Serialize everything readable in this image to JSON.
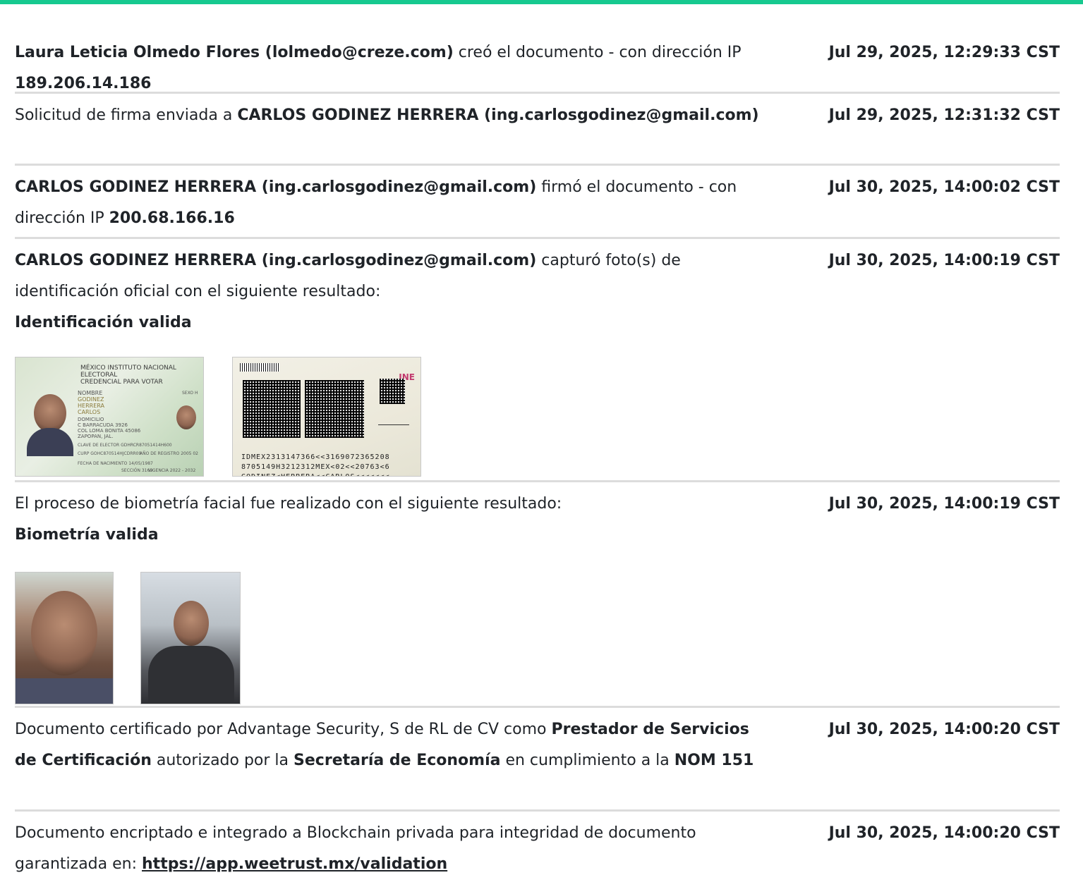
{
  "entries": [
    {
      "parts": [
        {
          "t": "Laura Leticia Olmedo Flores (lolmedo@creze.com)",
          "b": true
        },
        {
          "t": " creó el documento - con dirección IP ",
          "b": false
        },
        {
          "t": "189.206.14.186",
          "b": true
        }
      ],
      "date": "Jul 29, 2025, 12:29:33 CST"
    },
    {
      "parts": [
        {
          "t": "Solicitud de firma enviada a ",
          "b": false
        },
        {
          "t": "CARLOS GODINEZ HERRERA (ing.carlosgodinez@gmail.com)",
          "b": true
        }
      ],
      "date": "Jul 29, 2025, 12:31:32 CST"
    },
    {
      "parts": [
        {
          "t": "CARLOS GODINEZ HERRERA (ing.carlosgodinez@gmail.com)",
          "b": true
        },
        {
          "t": " firmó el documento - con dirección IP ",
          "b": false
        },
        {
          "t": "200.68.166.16",
          "b": true
        }
      ],
      "date": "Jul 30, 2025, 14:00:02 CST"
    },
    {
      "parts": [
        {
          "t": "CARLOS GODINEZ HERRERA (ing.carlosgodinez@gmail.com)",
          "b": true
        },
        {
          "t": " capturó foto(s) de identificación oficial con el siguiente resultado:",
          "b": false
        }
      ],
      "result": "Identificación valida",
      "date": "Jul 30, 2025, 14:00:19 CST",
      "images": {
        "front": {
          "header": "MÉXICO INSTITUTO NACIONAL ELECTORAL",
          "subheader": "CREDENCIAL PARA VOTAR",
          "name_lines": [
            "NOMBRE",
            "GODINEZ",
            "HERRERA",
            "CARLOS"
          ],
          "address_lines": [
            "DOMICILIO",
            "C BARRACUDA 3926",
            "COL LOMA BONITA 45086",
            "ZAPOPAN, JAL."
          ],
          "sex": "SEXO H",
          "clave": "CLAVE DE ELECTOR  GDHRCR87051414H600",
          "curp": "CURP  GOHC870514HJCDRR09",
          "registro": "AÑO DE REGISTRO 2005 02",
          "nacimiento": "FECHA DE NACIMIENTO 14/05/1987",
          "seccion": "SECCIÓN 3169",
          "vigencia": "VIGENCIA 2022 - 2032"
        },
        "back": {
          "logo": "INE",
          "mrz": [
            "IDMEX2313147366<<3169072365208",
            "8705149H3212312MEX<02<<20763<6",
            "GODINEZ<HERRERA<<CARLOS<<<<<<<"
          ]
        }
      }
    },
    {
      "parts": [
        {
          "t": "El proceso de biometría facial fue realizado con el siguiente resultado:",
          "b": false
        }
      ],
      "result": "Biometría valida",
      "date": "Jul 30, 2025, 14:00:19 CST"
    },
    {
      "parts": [
        {
          "t": "Documento certificado por Advantage Security, S de RL de CV como ",
          "b": false
        },
        {
          "t": "Prestador de Servicios de Certificación",
          "b": true
        },
        {
          "t": " autorizado por la ",
          "b": false
        },
        {
          "t": "Secretaría de Economía",
          "b": true
        },
        {
          "t": " en cumplimiento a la ",
          "b": false
        },
        {
          "t": "NOM 151",
          "b": true
        }
      ],
      "date": "Jul 30, 2025, 14:00:20 CST"
    },
    {
      "parts": [
        {
          "t": "Documento encriptado e integrado a Blockchain privada para integridad de documento garantizada en: ",
          "b": false
        }
      ],
      "link": "https://app.weetrust.mx/validation",
      "date": "Jul 30, 2025, 14:00:20 CST"
    }
  ],
  "colors": {
    "accent_bar": "#17c98f",
    "divider": "#dcdcdc",
    "text": "#1f2328"
  }
}
